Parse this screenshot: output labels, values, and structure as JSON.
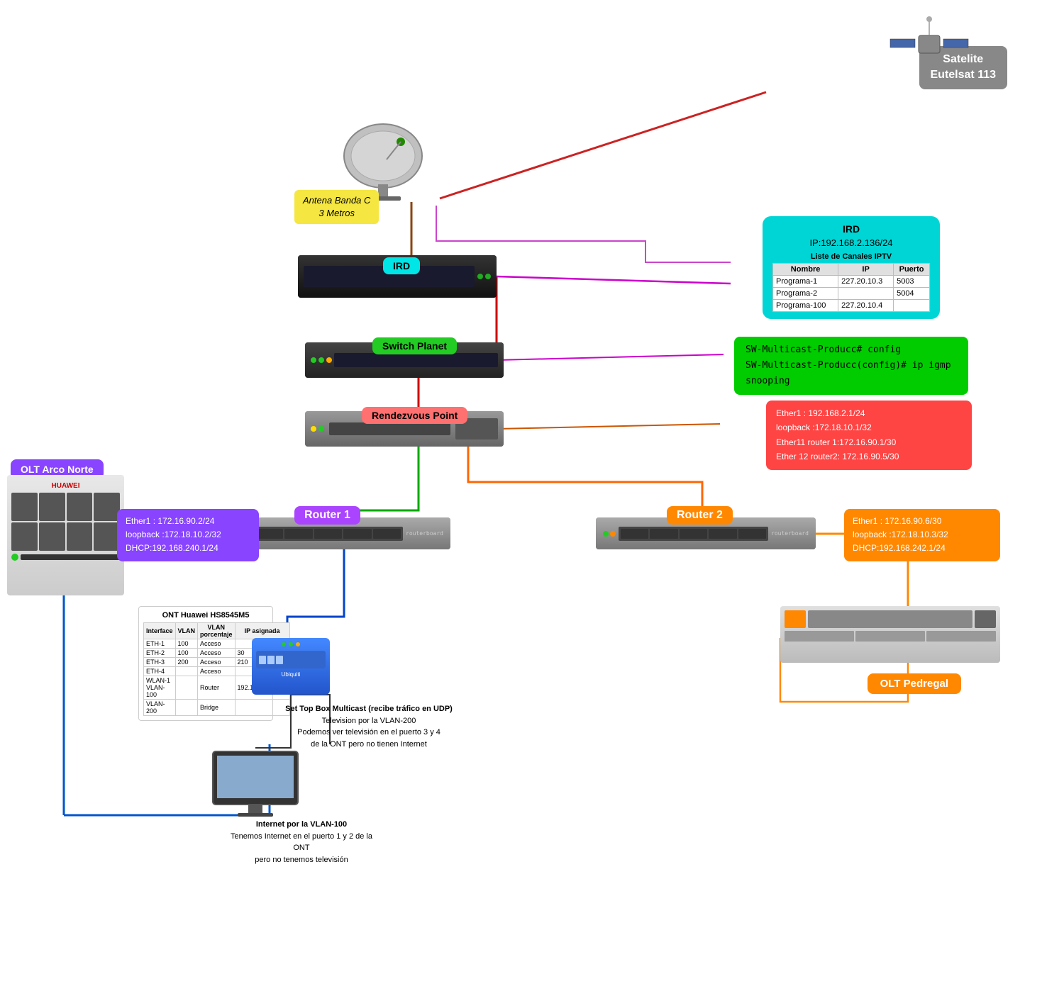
{
  "satellite": {
    "label_line1": "Satelite",
    "label_line2": "Eutelsat 113"
  },
  "antena": {
    "label_line1": "Antena Banda C",
    "label_line2": "3 Metros"
  },
  "ird": {
    "device_label": "IRD",
    "info_title": "IRD",
    "ip": "IP:192.168.2.136/24",
    "table_title": "Liste de Canales IPTV",
    "columns": [
      "Nombre",
      "IP",
      "Puerto"
    ],
    "rows": [
      [
        "Programa-1",
        "227.20.10.3",
        "5003"
      ],
      [
        "Programa-2",
        "",
        "",
        "5004"
      ],
      [
        "Programa-100",
        "227.20.10.4",
        ""
      ]
    ]
  },
  "switch_planet": {
    "label": "Switch Planet",
    "cmd1": "SW-Multicast-Producc# config",
    "cmd2": "SW-Multicast-Producc(config)# ip igmp snooping"
  },
  "rendezvous_point": {
    "label": "Rendezvous Point",
    "info": {
      "line1": "Ether1 : 192.168.2.1/24",
      "line2": "loopback :172.18.10.1/32",
      "line3": "Ether11 router 1:172.16.90.1/30",
      "line4": "Ether 12 router2: 172.16.90.5/30"
    }
  },
  "olt_arco": {
    "label": "OLT Arco Norte",
    "huawei": "HUAWEI"
  },
  "router1": {
    "label": "Router  1",
    "info": {
      "line1": "Ether1 : 172.16.90.2/24",
      "line2": "loopback :172.18.10.2/32",
      "line3": "DHCP:192.168.240.1/24"
    }
  },
  "router2": {
    "label": "Router  2",
    "info": {
      "line1": "Ether1 : 172.16.90.6/30",
      "line2": "loopback :172.18.10.3/32",
      "line3": "DHCP:192.168.242.1/24"
    }
  },
  "olt_pedregal": {
    "label": "OLT Pedregal"
  },
  "ont": {
    "title": "ONT Huawei HS8545M5",
    "columns": [
      "Interface",
      "VLAN",
      "VLAN porcentaje",
      "IP asignada"
    ],
    "rows": [
      [
        "ETH-1",
        "100",
        "Acceso",
        ""
      ],
      [
        "ETH-2",
        "100",
        "Acceso",
        "30"
      ],
      [
        "ETH-3",
        "200",
        "Acceso",
        "210"
      ],
      [
        "ETH-4",
        "",
        "Acceso",
        ""
      ],
      [
        "WLAN-1 VLAN-100",
        "",
        "Router",
        "192.168.100.5/24"
      ],
      [
        "VLAN-200",
        "",
        "Bridge",
        ""
      ]
    ]
  },
  "stb": {
    "title": "Set Top Box Multicast (recibe tráfico en UDP)",
    "line1": "Television por la VLAN-200",
    "line2": "Podemos ver televisión en el puerto 3 y 4",
    "line3": "de la ONT pero no tienen Internet"
  },
  "internet": {
    "line1": "Internet por la VLAN-100",
    "line2": "Tenemos Internet en el puerto 1 y 2 de la ONT",
    "line3": "pero no tenemos televisión"
  }
}
